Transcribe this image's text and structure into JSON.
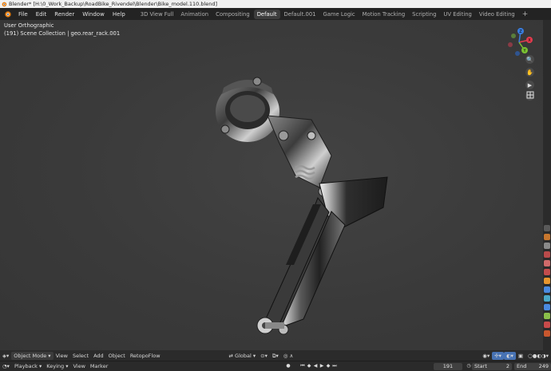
{
  "window": {
    "title": "Blender* [H:\\0_Work_Backup\\RoadBike_Rivendel\\Blender\\Bike_model.110.blend]"
  },
  "menubar": {
    "items": [
      "File",
      "Edit",
      "Render",
      "Window",
      "Help"
    ]
  },
  "workspaces": {
    "tabs": [
      "3D View Full",
      "Animation",
      "Compositing",
      "Default",
      "Default.001",
      "Game Logic",
      "Motion Tracking",
      "Scripting",
      "UV Editing",
      "Video Editing"
    ],
    "active": "Default",
    "add_label": "+"
  },
  "viewport": {
    "view_name": "User Orthographic",
    "collection_info": "(191) Scene Collection | geo.rear_rack.001",
    "gizmo": {
      "x": "X",
      "y": "Y",
      "z": "Z"
    },
    "bg_color": "#3a3a3a"
  },
  "header3d": {
    "mode": "Object Mode",
    "menus": [
      "View",
      "Select",
      "Add",
      "Object",
      "RetopoFlow"
    ],
    "transform_orientation": "Global"
  },
  "timeline": {
    "menus": [
      "Playback",
      "Keying",
      "View",
      "Marker"
    ],
    "current_frame": "191",
    "start_label": "Start",
    "start_value": "2",
    "end_label": "End",
    "end_value": "249"
  },
  "colors": {
    "accent": "#4772b3",
    "gizmo_x": "#e33b4e",
    "gizmo_y": "#7bc232",
    "gizmo_z": "#3a7ee0"
  }
}
